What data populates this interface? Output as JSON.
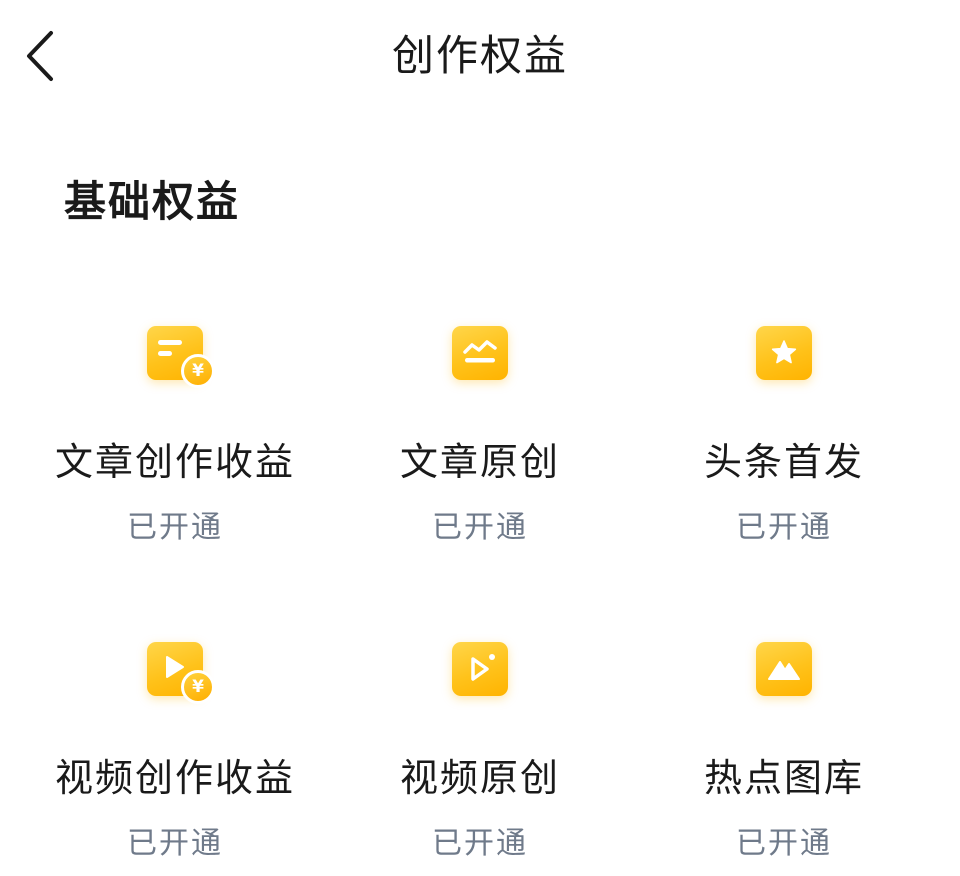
{
  "header": {
    "title": "创作权益"
  },
  "section": {
    "title": "基础权益"
  },
  "benefits": [
    {
      "label": "文章创作收益",
      "status": "已开通",
      "icon": "article-revenue-icon",
      "coin": "¥"
    },
    {
      "label": "文章原创",
      "status": "已开通",
      "icon": "article-original-icon"
    },
    {
      "label": "头条首发",
      "status": "已开通",
      "icon": "star-badge-icon"
    },
    {
      "label": "视频创作收益",
      "status": "已开通",
      "icon": "video-revenue-icon",
      "coin": "¥"
    },
    {
      "label": "视频原创",
      "status": "已开通",
      "icon": "video-original-icon"
    },
    {
      "label": "热点图库",
      "status": "已开通",
      "icon": "image-library-icon"
    }
  ],
  "colors": {
    "accent": "#ffc21a",
    "status_text": "#6f7a8a",
    "title_text": "#1a1a1a"
  }
}
